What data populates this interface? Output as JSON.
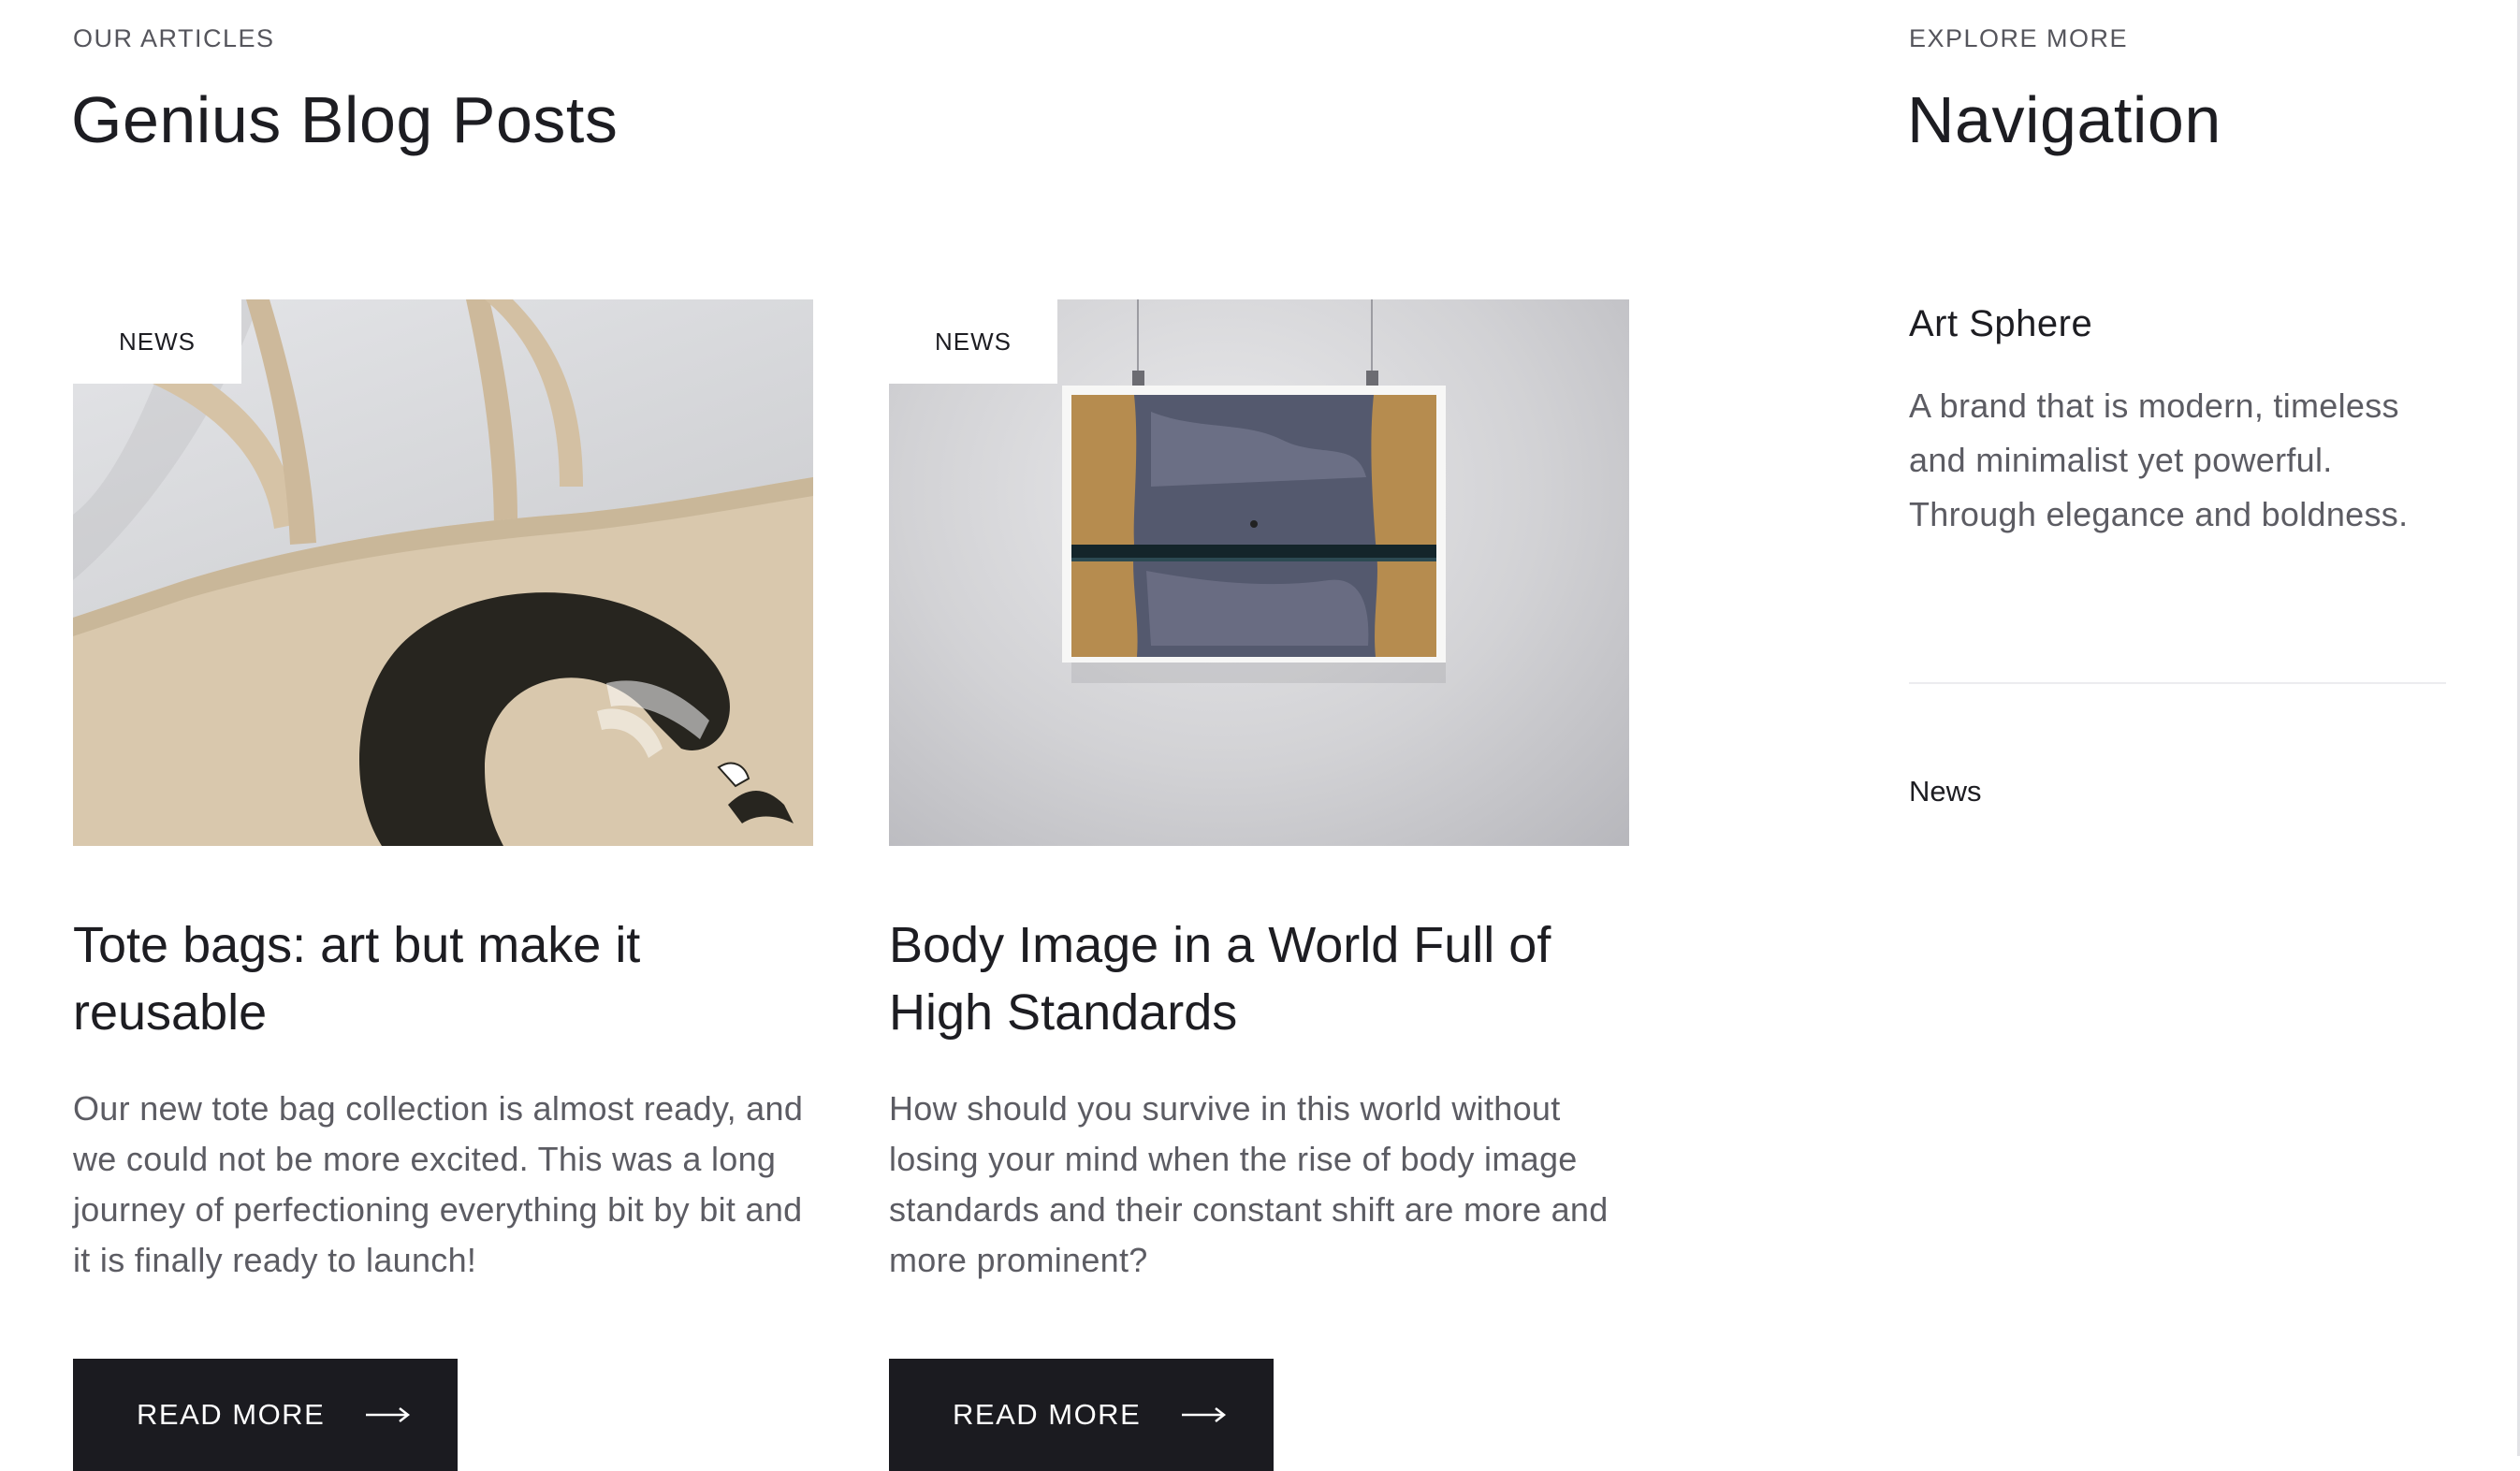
{
  "articles_section": {
    "eyebrow": "OUR ARTICLES",
    "title": "Genius Blog Posts"
  },
  "posts": [
    {
      "tag": "NEWS",
      "title": "Tote bags: art but make it reusable",
      "excerpt": "Our new tote bag collection is almost ready, and we could not be more excited. This was a long journey of perfectioning everything bit by bit and it is finally ready to launch!",
      "button": "READ MORE"
    },
    {
      "tag": "NEWS",
      "title": "Body Image in a World Full of High Standards",
      "excerpt": "How should you survive in this world without losing your mind when the rise of body image standards and their constant shift are more and more prominent?",
      "button": "READ MORE"
    }
  ],
  "sidebar": {
    "eyebrow": "EXPLORE MORE",
    "title": "Navigation",
    "brand_name": "Art Sphere",
    "brand_description": "A brand that is modern, timeless and minimalist yet powerful. Through elegance and boldness.",
    "categories": [
      "News"
    ]
  },
  "colors": {
    "text_dark": "#1d1d22",
    "text_muted": "#5c5c63",
    "button_bg": "#1b1b20",
    "tote_canvas": "#d9c8ad"
  },
  "icons": {
    "button_arrow": "long-arrow-right-icon"
  }
}
